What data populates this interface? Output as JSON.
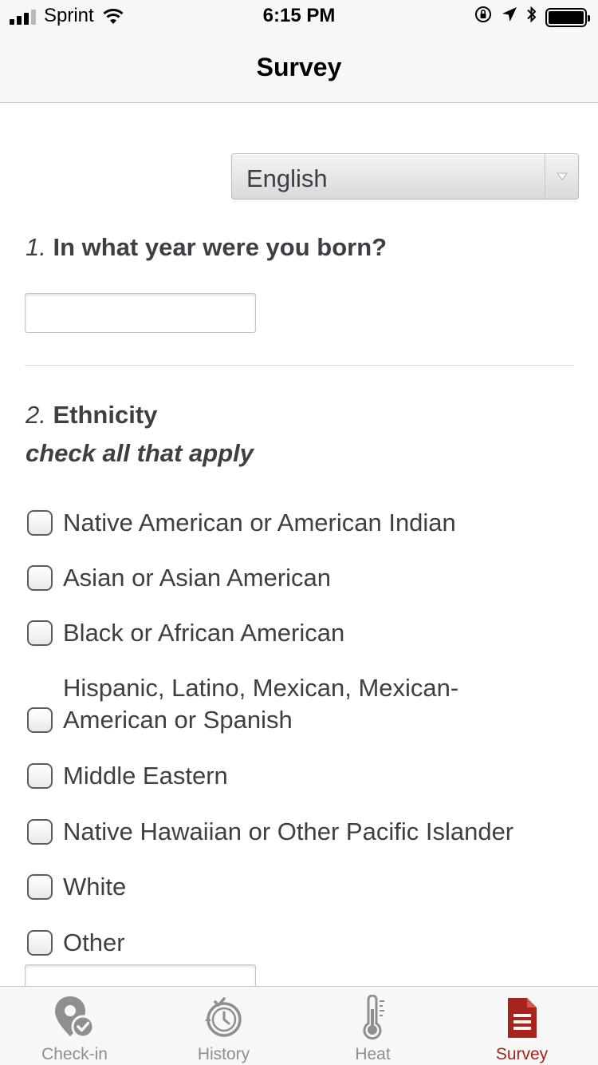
{
  "status_bar": {
    "carrier": "Sprint",
    "time": "6:15 PM"
  },
  "nav": {
    "title": "Survey"
  },
  "language": {
    "selected": "English"
  },
  "questions": [
    {
      "number": "1.",
      "text": "In what year were you born?",
      "input_value": ""
    },
    {
      "number": "2.",
      "text": "Ethnicity",
      "subtext": "check all that apply",
      "options": [
        "Native American or American Indian",
        "Asian or Asian American",
        "Black or African American",
        "Hispanic, Latino, Mexican, Mexican-",
        "American or Spanish",
        "Middle Eastern",
        "Native Hawaiian or Other Pacific Islander",
        "White",
        "Other"
      ]
    }
  ],
  "tabs": [
    {
      "label": "Check-in",
      "icon": "check-in-pin-icon"
    },
    {
      "label": "History",
      "icon": "history-clock-icon"
    },
    {
      "label": "Heat",
      "icon": "thermometer-icon"
    },
    {
      "label": "Survey",
      "icon": "survey-document-icon"
    }
  ],
  "colors": {
    "accent": "#a8231b",
    "inactive": "#8e8e93",
    "text": "#3d3f44"
  }
}
